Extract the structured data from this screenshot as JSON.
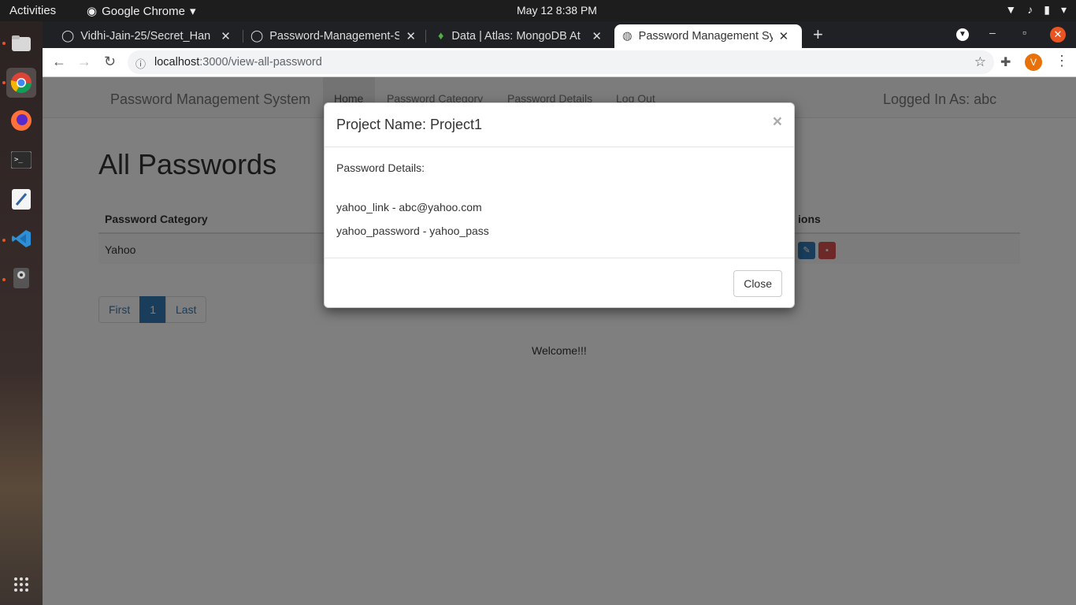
{
  "system": {
    "activities": "Activities",
    "app_name": "Google Chrome",
    "clock": "May 12  8:38 PM"
  },
  "browser": {
    "tabs": [
      {
        "title": "Vidhi-Jain-25/Secret_Han",
        "icon": "github-icon"
      },
      {
        "title": "Password-Management-S",
        "icon": "github-icon"
      },
      {
        "title": "Data | Atlas: MongoDB At",
        "icon": "mongodb-leaf-icon"
      },
      {
        "title": "Password Management Sy",
        "icon": "globe-icon",
        "active": true
      }
    ],
    "url_host": "localhost",
    "url_path": ":3000/view-all-password",
    "profile_initial": "V"
  },
  "app": {
    "brand": "Password Management System",
    "nav": [
      "Home",
      "Password Category",
      "Password Details",
      "Log Out"
    ],
    "logged_in": "Logged In As: abc",
    "page_title": "All Passwords",
    "table": {
      "headers": [
        "Password Category",
        "ions"
      ],
      "rows": [
        {
          "category": "Yahoo"
        }
      ]
    },
    "pagination": [
      "First",
      "1",
      "Last"
    ],
    "welcome": "Welcome!!!"
  },
  "modal": {
    "title": "Project Name: Project1",
    "close_symbol": "×",
    "details_label": "Password Details:",
    "lines": [
      "yahoo_link - abc@yahoo.com",
      "yahoo_password - yahoo_pass"
    ],
    "close_label": "Close"
  },
  "colors": {
    "primary": "#337ab7",
    "danger": "#d9534f",
    "ubuntu_orange": "#e95420"
  }
}
